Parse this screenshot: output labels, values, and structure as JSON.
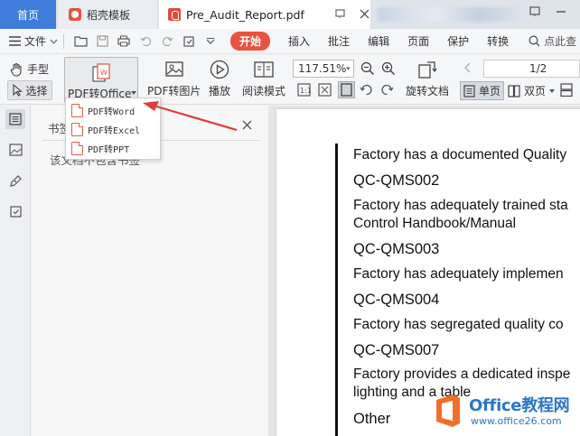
{
  "tabs": {
    "home": "首页",
    "docer": "稻壳模板",
    "pdf": "Pre_Audit_Report.pdf"
  },
  "menu": {
    "file": "文件",
    "start": "开始",
    "items": [
      "插入",
      "批注",
      "编辑",
      "页面",
      "保护",
      "转换"
    ],
    "search": "点此查"
  },
  "ribbon": {
    "hand": "手型",
    "select": "选择",
    "pdf_to_office": "PDF转Office",
    "pdf_to_image": "PDF转图片",
    "play": "播放",
    "read_mode": "阅读模式",
    "zoom": "117.51%",
    "rotate": "旋转文档",
    "single": "单页",
    "double": "双页",
    "page": "1/2"
  },
  "dropdown": {
    "items": [
      "PDF转Word",
      "PDF转Excel",
      "PDF转PPT"
    ]
  },
  "panel": {
    "title": "书签",
    "empty": "该文档不包含书签"
  },
  "document": {
    "lines": [
      "Factory has a documented Quality",
      "QC-QMS002",
      "Factory has adequately trained sta",
      "Control Handbook/Manual",
      "QC-QMS003",
      "Factory has adequately implemen",
      "QC-QMS004",
      "Factory has segregated quality co",
      "QC-QMS007",
      "Factory provides a dedicated inspe",
      "lighting and a table",
      "Other"
    ]
  },
  "watermark": {
    "title": "Office教程网",
    "url": "www.office26.com"
  },
  "colors": {
    "accent": "#3f7ddb",
    "start": "#e8533f",
    "watermark": "#2b76c8",
    "arrow": "#e23b3b"
  }
}
